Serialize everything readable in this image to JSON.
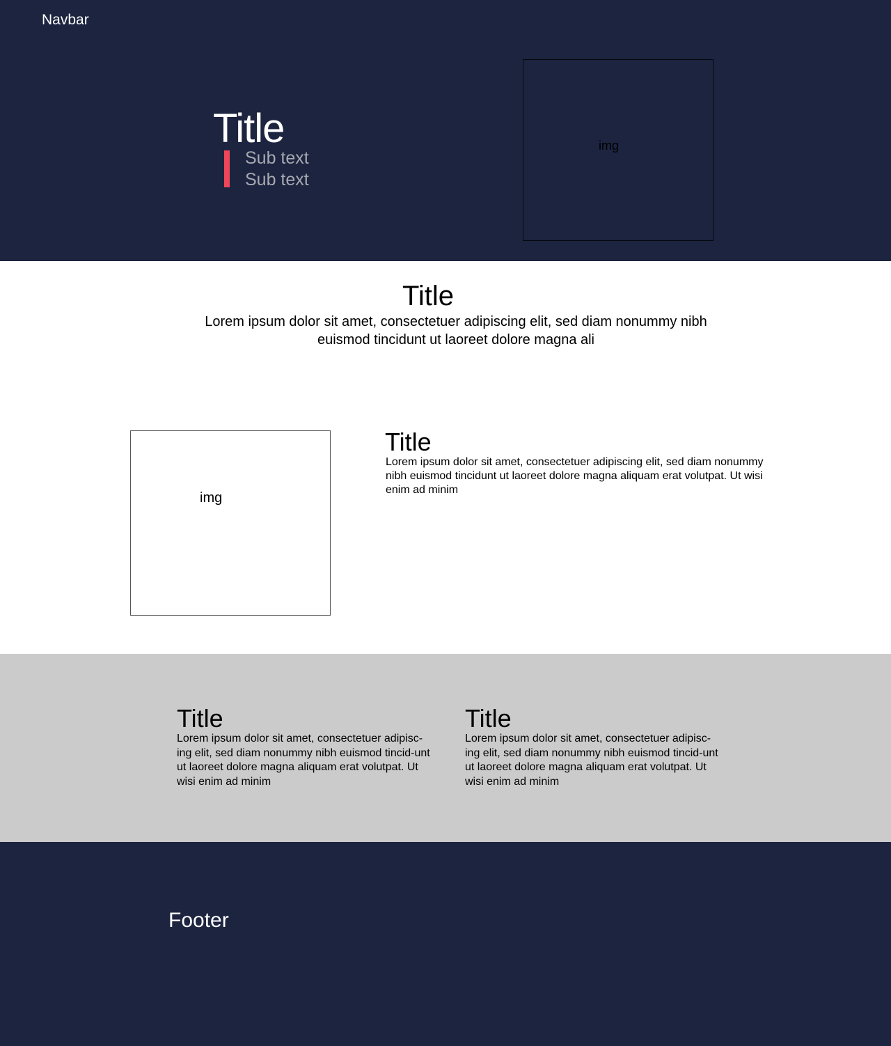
{
  "navbar": {
    "label": "Navbar"
  },
  "hero": {
    "title": "Title",
    "subtexts": [
      "Sub text",
      "Sub text"
    ],
    "image_label": "img",
    "colors": {
      "background": "#1d2440",
      "accent": "#f0465a",
      "subtext": "#a7a9b0"
    }
  },
  "intro": {
    "title": "Title",
    "body": "Lorem ipsum dolor sit amet, consectetuer adipiscing elit, sed diam nonummy nibh euismod tincidunt ut laoreet dolore magna ali"
  },
  "feature": {
    "image_label": "img",
    "title": "Title",
    "body": "Lorem ipsum dolor sit amet, consectetuer adipiscing elit, sed diam nonummy nibh euismod tincidunt ut laoreet dolore magna aliquam erat volutpat. Ut wisi enim ad minim"
  },
  "columns": [
    {
      "title": "Title",
      "body": "Lorem ipsum dolor sit amet, consectetuer adipisc-ing elit, sed diam nonummy nibh euismod tincid-unt ut laoreet dolore magna aliquam erat volutpat. Ut wisi enim ad minim"
    },
    {
      "title": "Title",
      "body": "Lorem ipsum dolor sit amet, consectetuer adipisc-ing elit, sed diam nonummy nibh euismod tincid-unt ut laoreet dolore magna aliquam erat volutpat. Ut wisi enim ad minim"
    }
  ],
  "footer": {
    "label": "Footer"
  },
  "colors": {
    "gray_section": "#cbcbcb",
    "white_section": "#ffffff"
  }
}
